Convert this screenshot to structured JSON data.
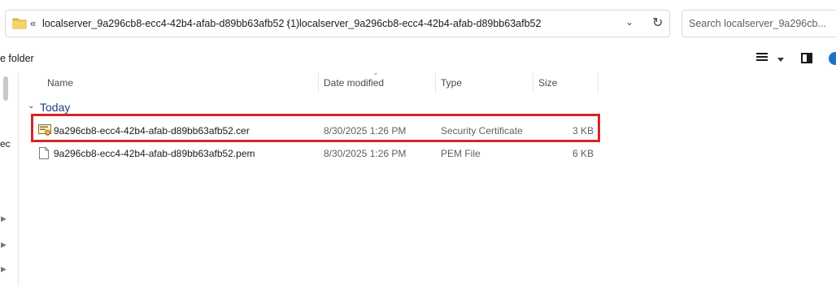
{
  "address_bar": {
    "overflow_glyph": "«",
    "crumbs": [
      "localserver_9a296cb8-ecc4-42b4-afab-d89bb63afb52 (1)",
      "localserver_9a296cb8-ecc4-42b4-afab-d89bb63afb52"
    ],
    "separator": "›",
    "dropdown_glyph": "⌄",
    "refresh_glyph": "↻"
  },
  "search": {
    "placeholder": "Search localserver_9a296cb..."
  },
  "command_bar": {
    "partial_label": "e folder"
  },
  "nav_pane": {
    "partial_text": "ec"
  },
  "columns": {
    "name": "Name",
    "date_modified": "Date modified",
    "type": "Type",
    "size": "Size"
  },
  "group": {
    "label": "Today",
    "chevron": "⌄"
  },
  "files": [
    {
      "name": "9a296cb8-ecc4-42b4-afab-d89bb63afb52.cer",
      "date": "8/30/2025 1:26 PM",
      "type": "Security Certificate",
      "size": "3 KB",
      "icon": "certificate-icon",
      "highlighted": true
    },
    {
      "name": "9a296cb8-ecc4-42b4-afab-d89bb63afb52.pem",
      "date": "8/30/2025 1:26 PM",
      "type": "PEM File",
      "size": "6 KB",
      "icon": "document-icon",
      "highlighted": false
    }
  ],
  "colors": {
    "highlight": "#d42626",
    "group": "#1f3d8a",
    "accent": "#1a73c9"
  }
}
